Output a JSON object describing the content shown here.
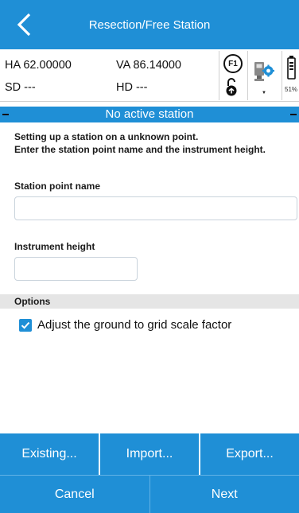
{
  "header": {
    "title": "Resection/Free Station"
  },
  "measurements": {
    "ha": "HA 62.00000",
    "va": "VA 86.14000",
    "sd": "SD ---",
    "hd": "HD ---"
  },
  "toolbar": {
    "f1_label": "F1",
    "battery": "51%"
  },
  "status": {
    "text": "No active station"
  },
  "intro": {
    "line1": "Setting up a station on a unknown point.",
    "line2": "Enter the station point name and the instrument height."
  },
  "form": {
    "station_label": "Station point name",
    "station_value": "",
    "height_label": "Instrument height",
    "height_value": ""
  },
  "options": {
    "header": "Options",
    "adjust_label": "Adjust the ground to grid scale factor",
    "adjust_checked": true
  },
  "actions": {
    "existing": "Existing...",
    "import": "Import...",
    "export": "Export..."
  },
  "footer": {
    "cancel": "Cancel",
    "next": "Next"
  },
  "colors": {
    "accent": "#1f8fd6"
  },
  "icons": [
    "back-chevron-icon",
    "f1-icon",
    "lock-icon",
    "station-config-icon",
    "battery-icon",
    "checkmark-icon"
  ]
}
